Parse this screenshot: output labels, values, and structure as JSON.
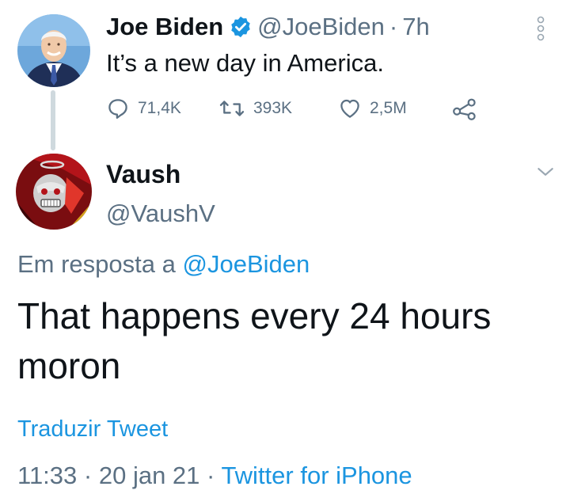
{
  "parent_tweet": {
    "author_name": "Joe Biden",
    "handle": "@JoeBiden",
    "separator": "·",
    "time": "7h",
    "text": "It’s a new day in America.",
    "verified_icon": "verified-badge-icon",
    "actions": {
      "reply_count": "71,4K",
      "retweet_count": "393K",
      "like_count": "2,5M"
    }
  },
  "reply_tweet": {
    "author_name": "Vaush",
    "handle": "@VaushV",
    "reply_context_prefix": "Em resposta a",
    "reply_context_mention": "@JoeBiden",
    "text": "That happens every 24 hours moron",
    "translate_label": "Traduzir Tweet",
    "time": "11:33",
    "separator": "·",
    "date": "20 jan 21",
    "source": "Twitter for iPhone"
  },
  "colors": {
    "accent": "#1b95e0",
    "text_primary": "#0f1419",
    "text_secondary": "#5b7083",
    "thread_line": "#cfd9de"
  },
  "icons": [
    "more-options-icon",
    "verified-badge-icon",
    "reply-icon",
    "retweet-icon",
    "like-icon",
    "share-icon",
    "chevron-down-icon"
  ]
}
